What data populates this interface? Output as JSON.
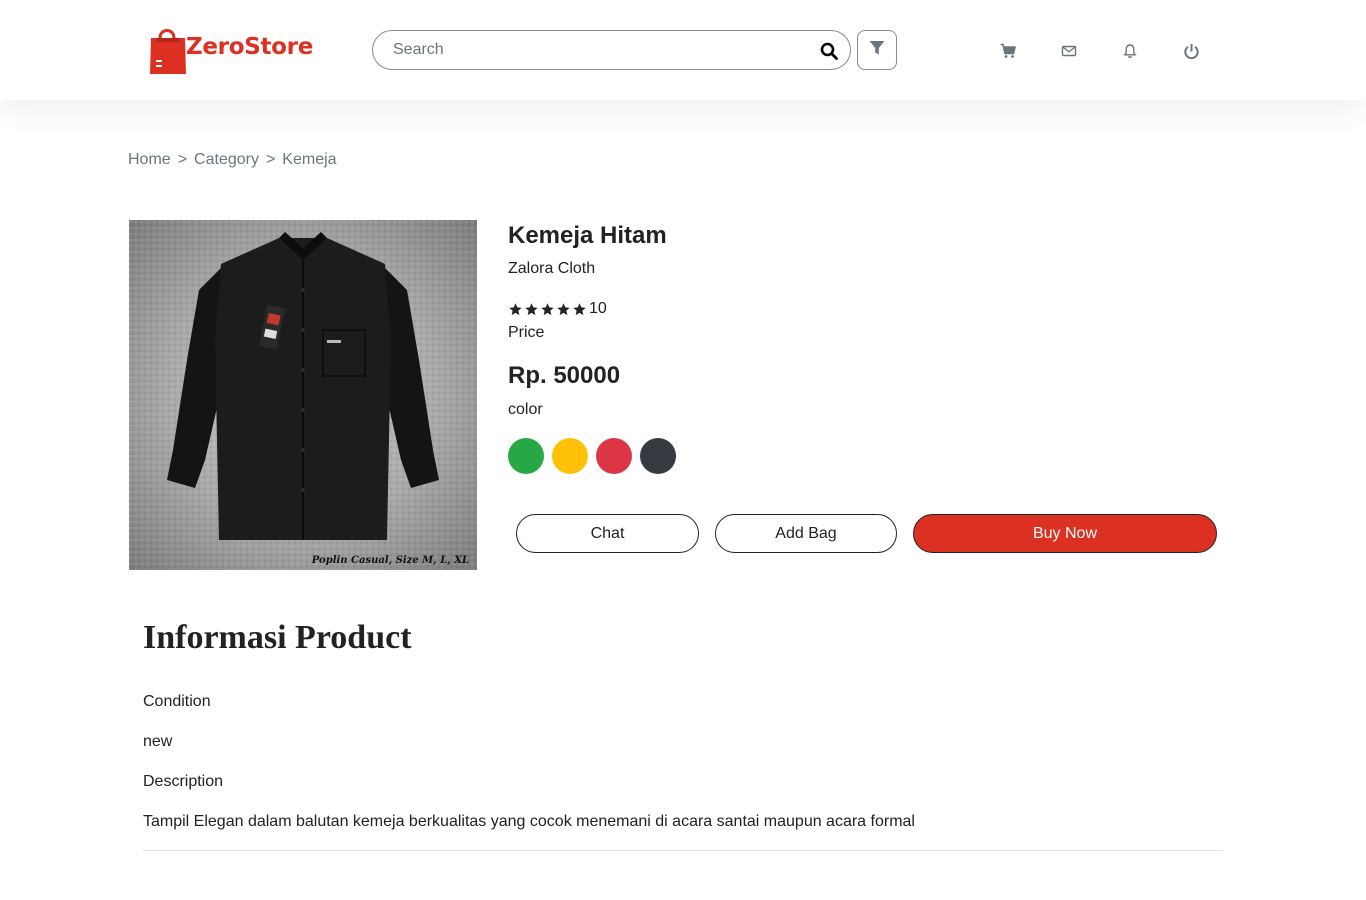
{
  "header": {
    "brand": "ZeroStore",
    "search_placeholder": "Search",
    "nav_icons": [
      "cart-icon",
      "mail-icon",
      "bell-icon",
      "power-icon"
    ]
  },
  "breadcrumb": [
    "Home",
    "Category",
    "Kemeja"
  ],
  "product": {
    "title": "Kemeja Hitam",
    "brand": "Zalora Cloth",
    "rating_stars": 5,
    "rating_count": "10",
    "price_label": "Price",
    "price": "Rp. 50000",
    "color_label": "color",
    "colors": [
      "#28a745",
      "#ffc107",
      "#dc3545",
      "#343a40"
    ],
    "image_caption": "Poplin Casual, Size M, L, XL"
  },
  "actions": {
    "chat": "Chat",
    "add_bag": "Add Bag",
    "buy_now": "Buy Now"
  },
  "info": {
    "title": "Informasi Product",
    "condition_label": "Condition",
    "condition_value": "new",
    "description_label": "Description",
    "description_value": "Tampil Elegan dalam balutan kemeja berkualitas yang cocok menemani di acara santai maupun acara formal"
  },
  "theme": {
    "accent": "#DB3022"
  }
}
